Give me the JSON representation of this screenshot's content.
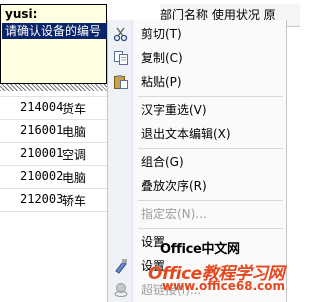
{
  "header": {
    "text": "部门名称 使用状况 原"
  },
  "rows": [
    {
      "code": "214004",
      "name": "货车"
    },
    {
      "code": "216001",
      "name": "电脑"
    },
    {
      "code": "210001",
      "name": "空调"
    },
    {
      "code": "210002",
      "name": "电脑"
    },
    {
      "code": "212003",
      "name": "轿车"
    }
  ],
  "comment": {
    "author": "yusi:",
    "text": "请确认设备的编号"
  },
  "context_menu": {
    "items": [
      {
        "label": "剪切(T)",
        "icon": "scissors-icon",
        "enabled": true
      },
      {
        "label": "复制(C)",
        "icon": "copy-icon",
        "enabled": true
      },
      {
        "label": "粘贴(P)",
        "icon": "paste-icon",
        "enabled": true
      },
      {
        "label": "汉字重选(V)",
        "enabled": true
      },
      {
        "label": "退出文本编辑(X)",
        "enabled": true
      },
      {
        "label": "组合(G)",
        "enabled": true
      },
      {
        "label": "叠放次序(R)",
        "enabled": true
      },
      {
        "label": "指定宏(N)...",
        "enabled": false
      },
      {
        "label": "设置",
        "enabled": true
      },
      {
        "label": "设置",
        "icon": "format-icon",
        "enabled": true
      },
      {
        "label": "超链接(I)...",
        "icon": "hyperlink-icon",
        "enabled": false
      }
    ]
  },
  "watermark": {
    "line1": "Office中文网",
    "line2": "Office教程学习网",
    "line3": "www.office68.com"
  },
  "colors": {
    "comment_bg": "#ffffe1",
    "selection_bg": "#0a246a",
    "watermark_red": "#e5481e"
  }
}
